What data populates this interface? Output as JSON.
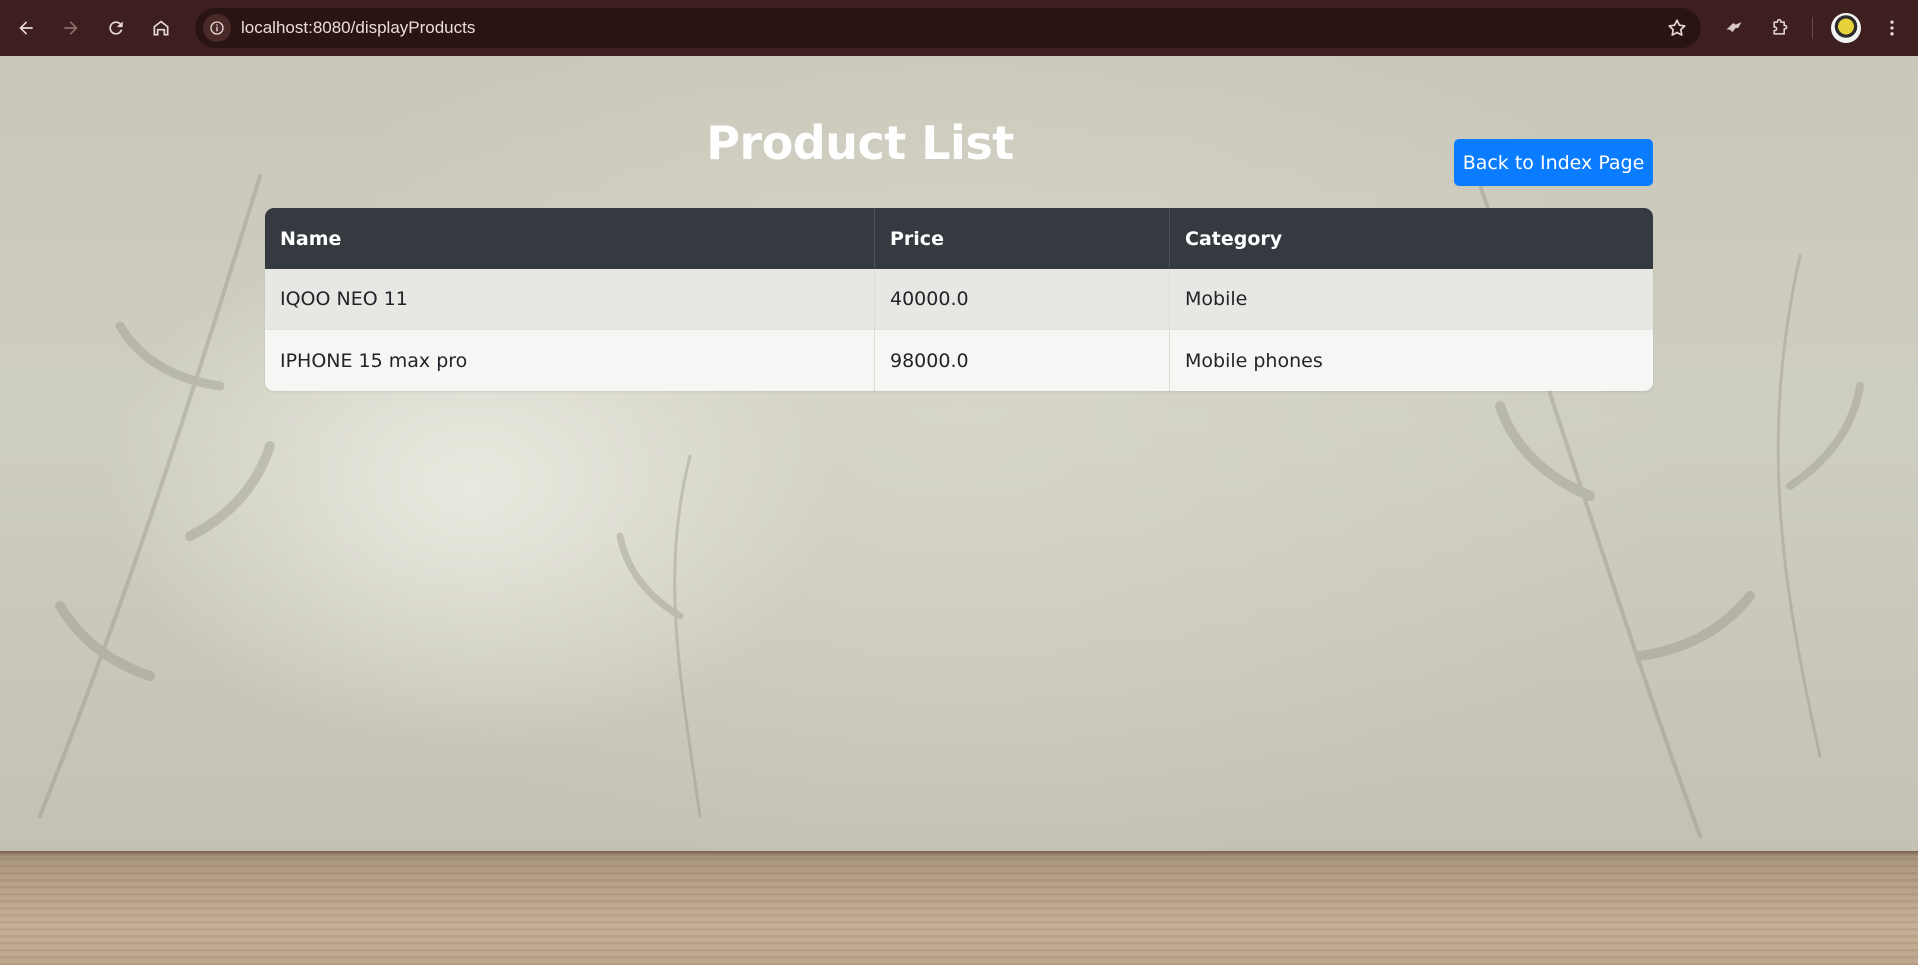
{
  "browser": {
    "url": "localhost:8080/displayProducts",
    "icons": [
      "back-icon",
      "forward-icon",
      "reload-icon",
      "home-icon",
      "site-info-icon",
      "bookmark-star-icon",
      "extension-bird-icon",
      "extensions-puzzle-icon",
      "profile-avatar",
      "menu-dots-icon"
    ]
  },
  "page": {
    "title": "Product List",
    "back_button_label": "Back to Index Page",
    "accent_color": "#0a7cff",
    "header_color": "#343a40"
  },
  "products_table": {
    "headers": [
      "Name",
      "Price",
      "Category"
    ],
    "rows": [
      {
        "name": "IQOO NEO 11",
        "price": "40000.0",
        "category": "Mobile"
      },
      {
        "name": "IPHONE 15 max pro",
        "price": "98000.0",
        "category": "Mobile phones"
      }
    ]
  }
}
